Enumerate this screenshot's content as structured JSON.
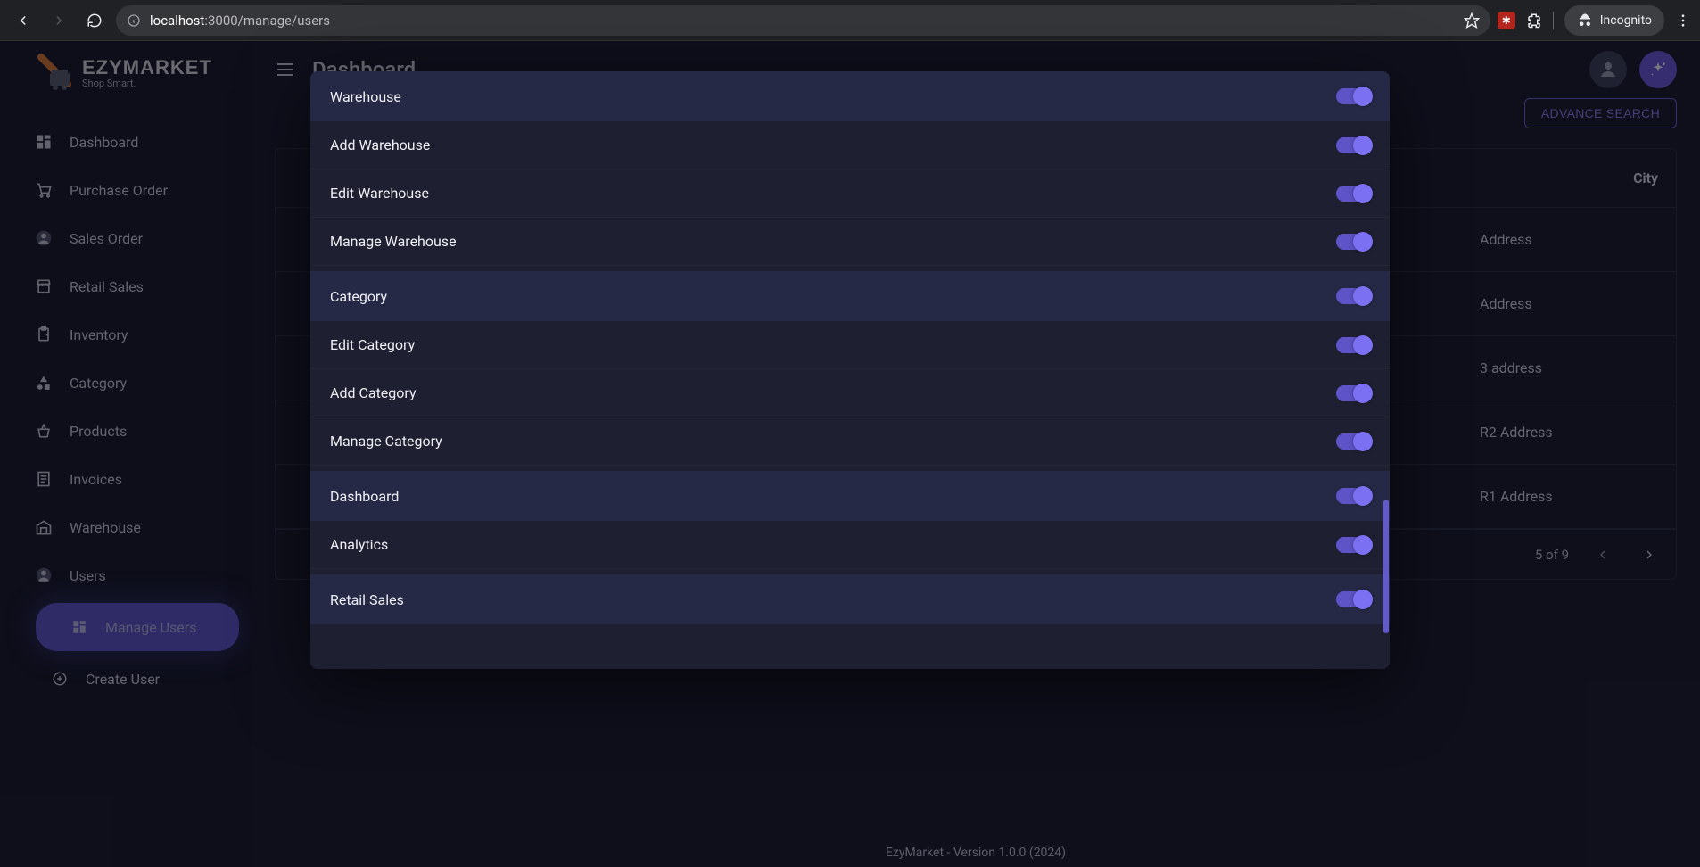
{
  "browser": {
    "url_prefix": "localhost",
    "url_rest": ":3000/manage/users",
    "incognito": "Incognito"
  },
  "brand": {
    "name": "EZYMARKET",
    "tagline": "Shop Smart."
  },
  "sidebar": {
    "items": [
      {
        "label": "Dashboard",
        "icon": "dashboard-icon"
      },
      {
        "label": "Purchase Order",
        "icon": "cart-icon"
      },
      {
        "label": "Sales Order",
        "icon": "account-icon"
      },
      {
        "label": "Retail Sales",
        "icon": "store-icon"
      },
      {
        "label": "Inventory",
        "icon": "clipboard-icon"
      },
      {
        "label": "Category",
        "icon": "shapes-icon"
      },
      {
        "label": "Products",
        "icon": "basket-icon"
      },
      {
        "label": "Invoices",
        "icon": "receipt-icon"
      },
      {
        "label": "Warehouse",
        "icon": "warehouse-icon"
      },
      {
        "label": "Users",
        "icon": "account-icon"
      }
    ],
    "sub_items": [
      {
        "label": "Manage Users",
        "icon": "dashboard-icon",
        "active": true
      },
      {
        "label": "Create User",
        "icon": "add-circle-icon"
      }
    ]
  },
  "header": {
    "page_title": "Dashboard",
    "advance_search": "ADVANCE SEARCH"
  },
  "table": {
    "headers": {
      "city": "City"
    },
    "rows": [
      {
        "address": "Address"
      },
      {
        "address": "Address"
      },
      {
        "address": "3 address"
      },
      {
        "address": "R2 Address"
      },
      {
        "address": "R1 Address"
      }
    ],
    "pagination": "5 of 9"
  },
  "footer": {
    "version": "EzyMarket - Version 1.0.0 (2024)"
  },
  "dialog": {
    "permissions": [
      {
        "type": "header",
        "label": "Warehouse",
        "on": true
      },
      {
        "type": "item",
        "label": "Add Warehouse",
        "on": true
      },
      {
        "type": "item",
        "label": "Edit Warehouse",
        "on": true
      },
      {
        "type": "item",
        "label": "Manage Warehouse",
        "on": true
      },
      {
        "type": "header",
        "label": "Category",
        "on": true
      },
      {
        "type": "item",
        "label": "Edit Category",
        "on": true
      },
      {
        "type": "item",
        "label": "Add Category",
        "on": true
      },
      {
        "type": "item",
        "label": "Manage Category",
        "on": true
      },
      {
        "type": "header",
        "label": "Dashboard",
        "on": true
      },
      {
        "type": "item",
        "label": "Analytics",
        "on": true
      },
      {
        "type": "header",
        "label": "Retail Sales",
        "on": true
      }
    ]
  }
}
